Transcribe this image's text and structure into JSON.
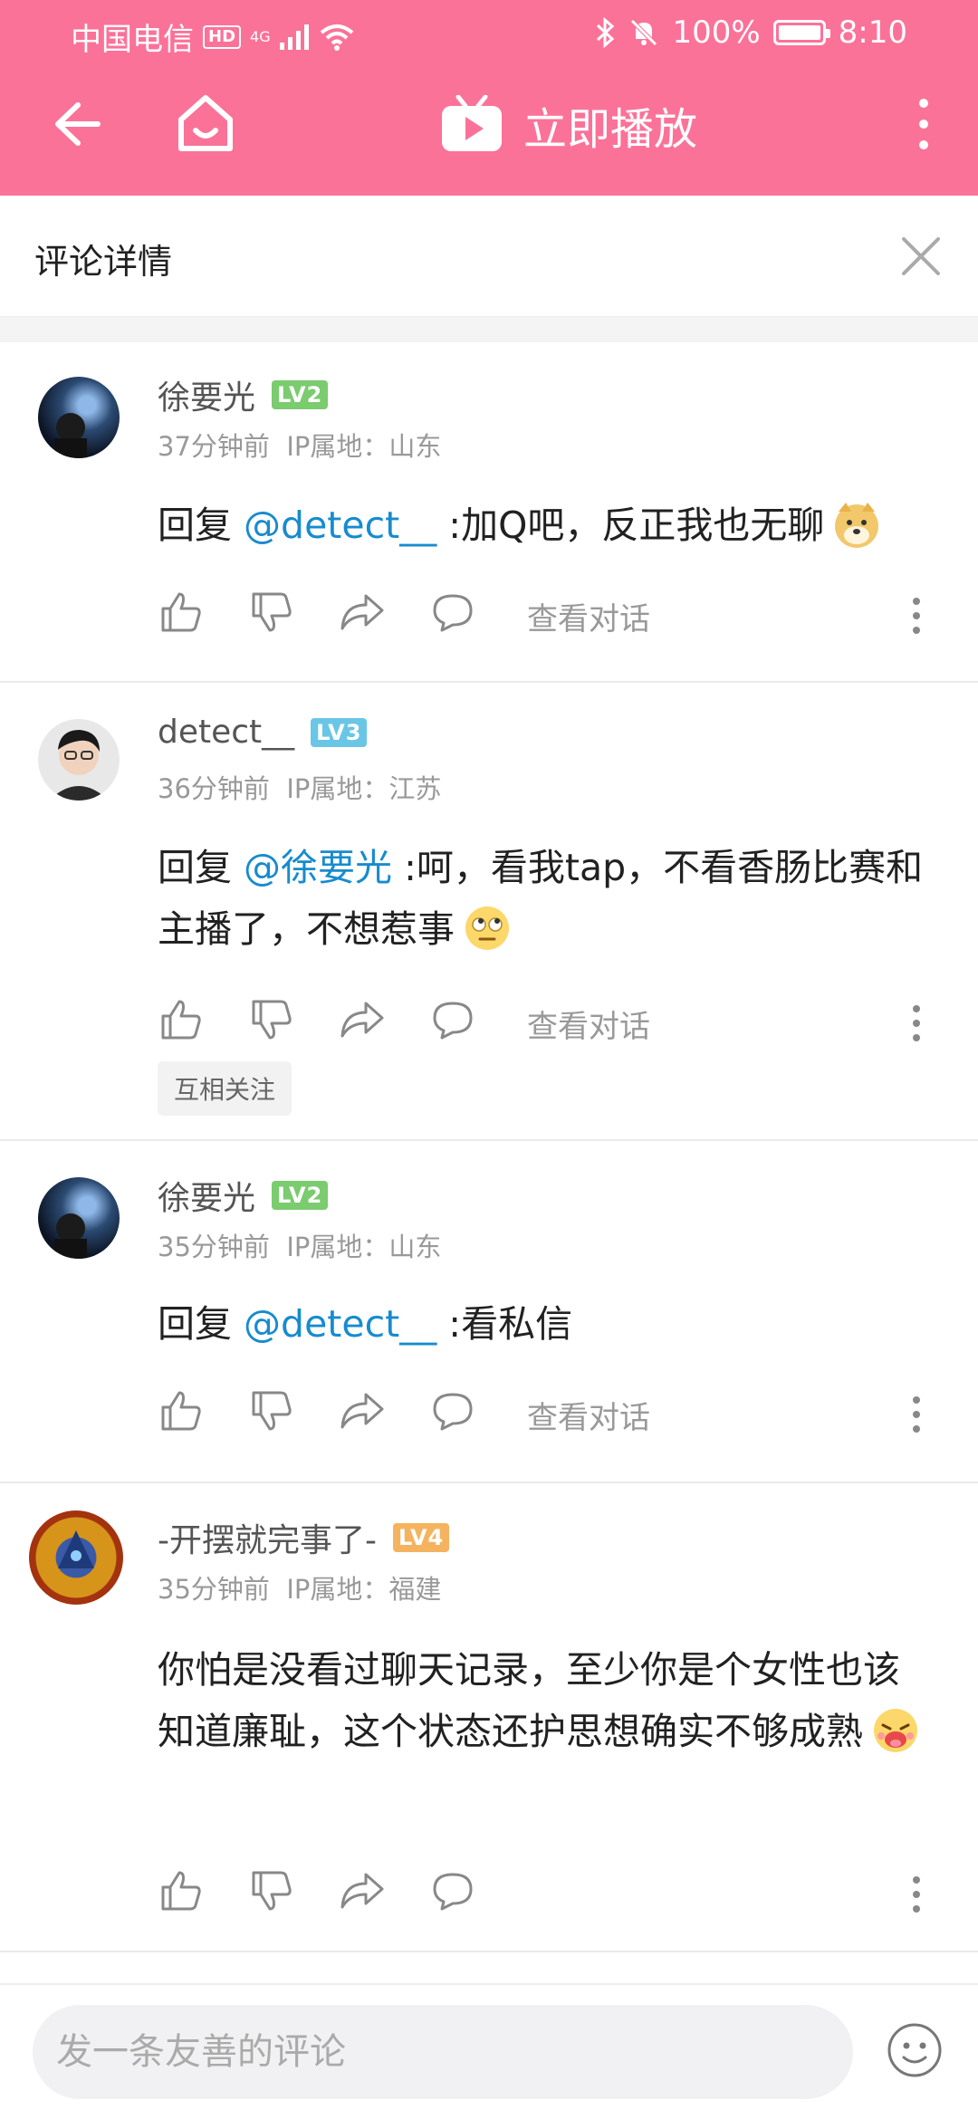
{
  "status_bar": {
    "carrier": "中国电信",
    "network": "4G",
    "battery": "100%",
    "time": "8:10"
  },
  "appbar": {
    "title": "立即播放"
  },
  "sheet": {
    "title": "评论详情"
  },
  "comments": [
    {
      "user": "徐要光",
      "level": "LV2",
      "level_color": "#7bcb6f",
      "time": "37分钟前",
      "ip": "IP属地：山东",
      "reply_prefix": "回复",
      "mention": "@detect__",
      "text": ":加Q吧，反正我也无聊",
      "view_conv": "查看对话"
    },
    {
      "user": "detect__",
      "level": "LV3",
      "level_color": "#6ac6e6",
      "time": "36分钟前",
      "ip": "IP属地：江苏",
      "reply_prefix": "回复",
      "mention": "@徐要光",
      "text": ":呵，看我tap，不看香肠比赛和主播了，不想惹事",
      "view_conv": "查看对话",
      "tag": "互相关注"
    },
    {
      "user": "徐要光",
      "level": "LV2",
      "level_color": "#7bcb6f",
      "time": "35分钟前",
      "ip": "IP属地：山东",
      "reply_prefix": "回复",
      "mention": "@detect__",
      "text": ":看私信",
      "view_conv": "查看对话"
    },
    {
      "user": "-开摆就完事了-",
      "level": "LV4",
      "level_color": "#f5b35f",
      "time": "35分钟前",
      "ip": "IP属地：福建",
      "text": "你怕是没看过聊天记录，至少你是个女性也该知道廉耻，这个状态还护思想确实不够成熟"
    }
  ],
  "bottom": {
    "placeholder": "发一条友善的评论"
  },
  "colors": {
    "brand_pink": "#fb7299",
    "mention_blue": "#178bcf"
  }
}
